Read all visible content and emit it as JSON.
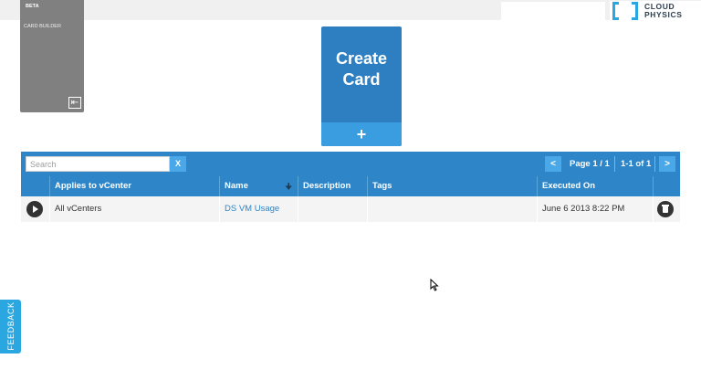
{
  "logo": {
    "text_line1": "CLOUD",
    "text_line2": "PHYSICS",
    "brand_color": "#2aa7e0"
  },
  "beta_card": {
    "label": "BETA",
    "subtitle": "CARD BUILDER",
    "exit_icon": "exit-icon"
  },
  "create_card": {
    "title": "Create\nCard",
    "plus": "+"
  },
  "toolbar": {
    "search_placeholder": "Search",
    "clear_label": "X",
    "prev_label": "<",
    "next_label": ">",
    "page_text": "Page 1 / 1",
    "range_text": "1-1 of 1"
  },
  "table": {
    "columns": [
      "Applies to vCenter",
      "Name",
      "Description",
      "Tags",
      "Executed On"
    ],
    "rows": [
      {
        "applies_to": "All vCenters",
        "name": "DS VM Usage",
        "description": "",
        "tags": "",
        "executed_on": "June 6 2013 8:22 PM"
      }
    ]
  },
  "feedback": {
    "label": "FEEDBACK"
  },
  "colors": {
    "header": "#2e86c8",
    "card": "#2e7fc1",
    "button": "#4aa8e8"
  }
}
